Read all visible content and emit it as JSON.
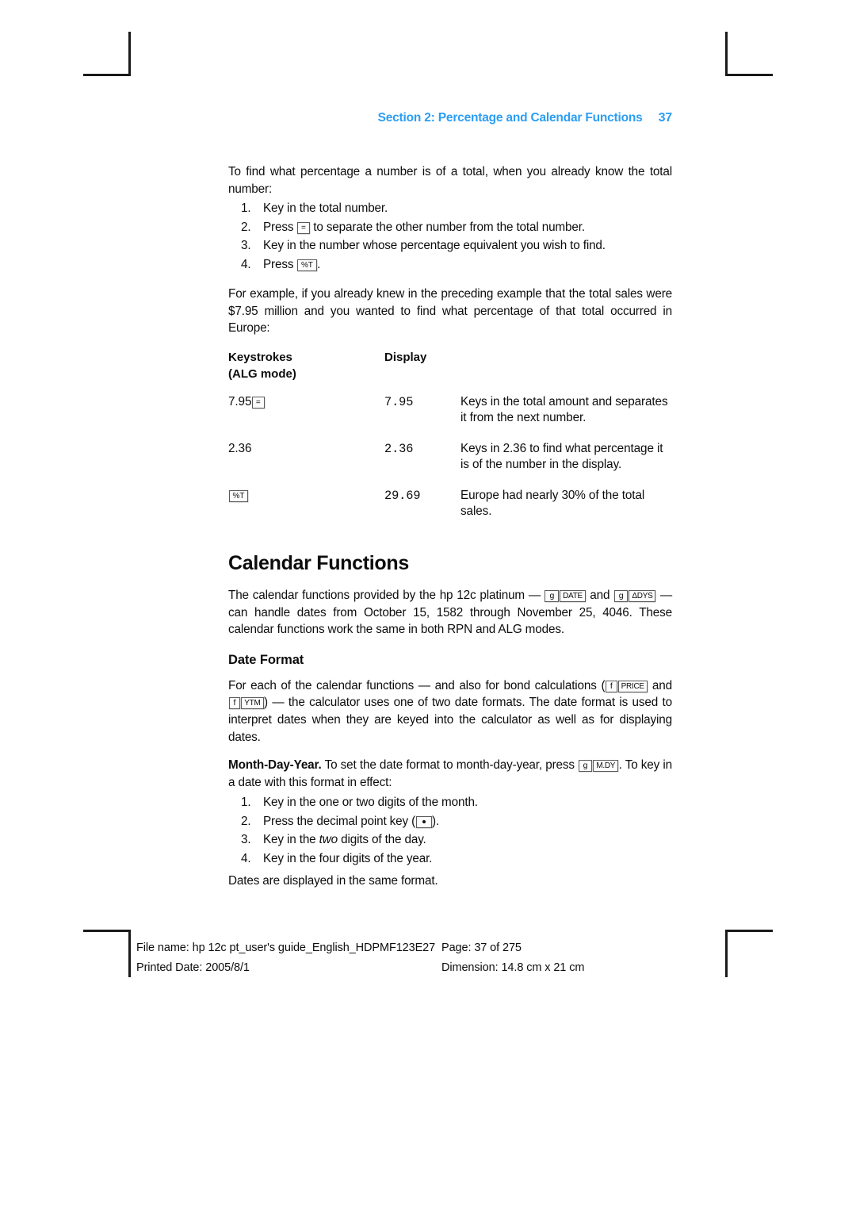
{
  "running_head": {
    "title": "Section 2: Percentage and Calendar Functions",
    "page_number": "37",
    "color": "#2b9ef4"
  },
  "intro": {
    "paragraph": "To find what percentage a number is of a total, when you already know the total number:",
    "steps": [
      {
        "num": "1.",
        "pre": "Key in the total number.",
        "key": "",
        "post": ""
      },
      {
        "num": "2.",
        "pre": "Press ",
        "key": "=",
        "post": " to separate the other number from the total number."
      },
      {
        "num": "3.",
        "pre": "Key in the number whose percentage equivalent you wish to find.",
        "key": "",
        "post": ""
      },
      {
        "num": "4.",
        "pre": "Press ",
        "key": "%T",
        "post": "."
      }
    ]
  },
  "example": {
    "paragraph": "For example, if you already knew in the preceding example that the total sales were $7.95 million and you wanted to find what percentage of that total occurred in Europe:"
  },
  "keystroke_table": {
    "headers": {
      "keystrokes_line1": "Keystrokes",
      "keystrokes_line2": "(ALG mode)",
      "display": "Display"
    },
    "rows": [
      {
        "keys_text": "7.95",
        "keys_glyph": "=",
        "display": "7.95",
        "description": "Keys in the total amount and separates it from the next number."
      },
      {
        "keys_text": "2.36",
        "keys_glyph": "",
        "display": "2.36",
        "description": "Keys in 2.36 to find what percentage it is of the number in the display."
      },
      {
        "keys_text": "",
        "keys_glyph": "%T",
        "display": "29.69",
        "description": "Europe had nearly 30% of the total sales."
      }
    ]
  },
  "calendar": {
    "heading": "Calendar Functions",
    "para_a": "The calendar functions provided by the hp 12c platinum — ",
    "key1_shift": "g",
    "key1_label": "DATE",
    "para_b": " and ",
    "key2_shift": "g",
    "key2_label": "ΔDYS",
    "para_c": " — can handle dates from October 15, 1582 through November 25, 4046. These calendar functions work the same in both RPN and ALG modes."
  },
  "date_format": {
    "heading": "Date Format",
    "para_a": "For each of the calendar functions — and also for bond calculations (",
    "key1_shift": "f",
    "key1_label": "PRICE",
    "para_b": " and ",
    "key2_shift": "f",
    "key2_label": "YTM",
    "para_c": ") — the calculator uses one of two date formats. The date format is used to interpret dates when they are keyed into the calculator as well as for displaying dates."
  },
  "mdy": {
    "lead": "Month-Day-Year.",
    "para_a": " To set the date format to month-day-year, press ",
    "key_shift": "g",
    "key_label": "M.DY",
    "para_b": ". To key in a date with this format in effect:",
    "steps": [
      {
        "num": "1.",
        "pre": "Key in the one or two digits of the month.",
        "key": "",
        "post": ""
      },
      {
        "num": "2.",
        "pre": "Press the decimal point key (",
        "key": "dot",
        "post": ")."
      },
      {
        "num": "3.",
        "pre": "Key in the ",
        "italic": "two",
        "post": " digits of the day."
      },
      {
        "num": "4.",
        "pre": "Key in the four digits of the year.",
        "key": "",
        "post": ""
      }
    ],
    "closing": "Dates are displayed in the same format."
  },
  "footer": {
    "file_name": "File name: hp 12c pt_user's guide_English_HDPMF123E27",
    "page": "Page: 37 of 275",
    "printed_date": "Printed Date: 2005/8/1",
    "dimension": "Dimension: 14.8 cm x 21 cm"
  }
}
